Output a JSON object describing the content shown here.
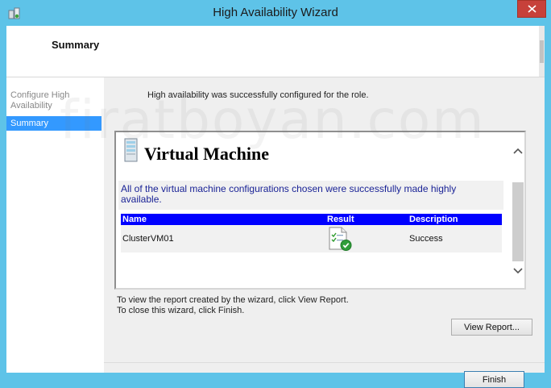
{
  "window": {
    "title": "High Availability Wizard"
  },
  "header": {
    "page_title": "Summary"
  },
  "nav": {
    "items": [
      {
        "label": "Configure High Availability",
        "state": "disabled"
      },
      {
        "label": "Summary",
        "state": "selected"
      }
    ]
  },
  "content": {
    "status_message": "High availability was successfully configured for the role.",
    "report": {
      "heading": "Virtual Machine",
      "summary": "All of the virtual machine configurations chosen were successfully made highly available.",
      "columns": [
        "Name",
        "Result",
        "Description"
      ],
      "rows": [
        {
          "name": "ClusterVM01",
          "result_icon": "success-report-icon",
          "description": "Success"
        }
      ]
    },
    "instructions": {
      "line1": "To view the report created by the wizard, click View Report.",
      "line2": "To close this wizard, click Finish."
    },
    "buttons": {
      "view_report": "View Report...",
      "finish": "Finish"
    }
  },
  "watermark": "firatboyan.com",
  "colors": {
    "titlebar": "#5ec3e8",
    "close_button": "#c7413a",
    "nav_selected": "#3399ff",
    "table_header": "#0000ff",
    "summary_text": "#1a2396"
  }
}
